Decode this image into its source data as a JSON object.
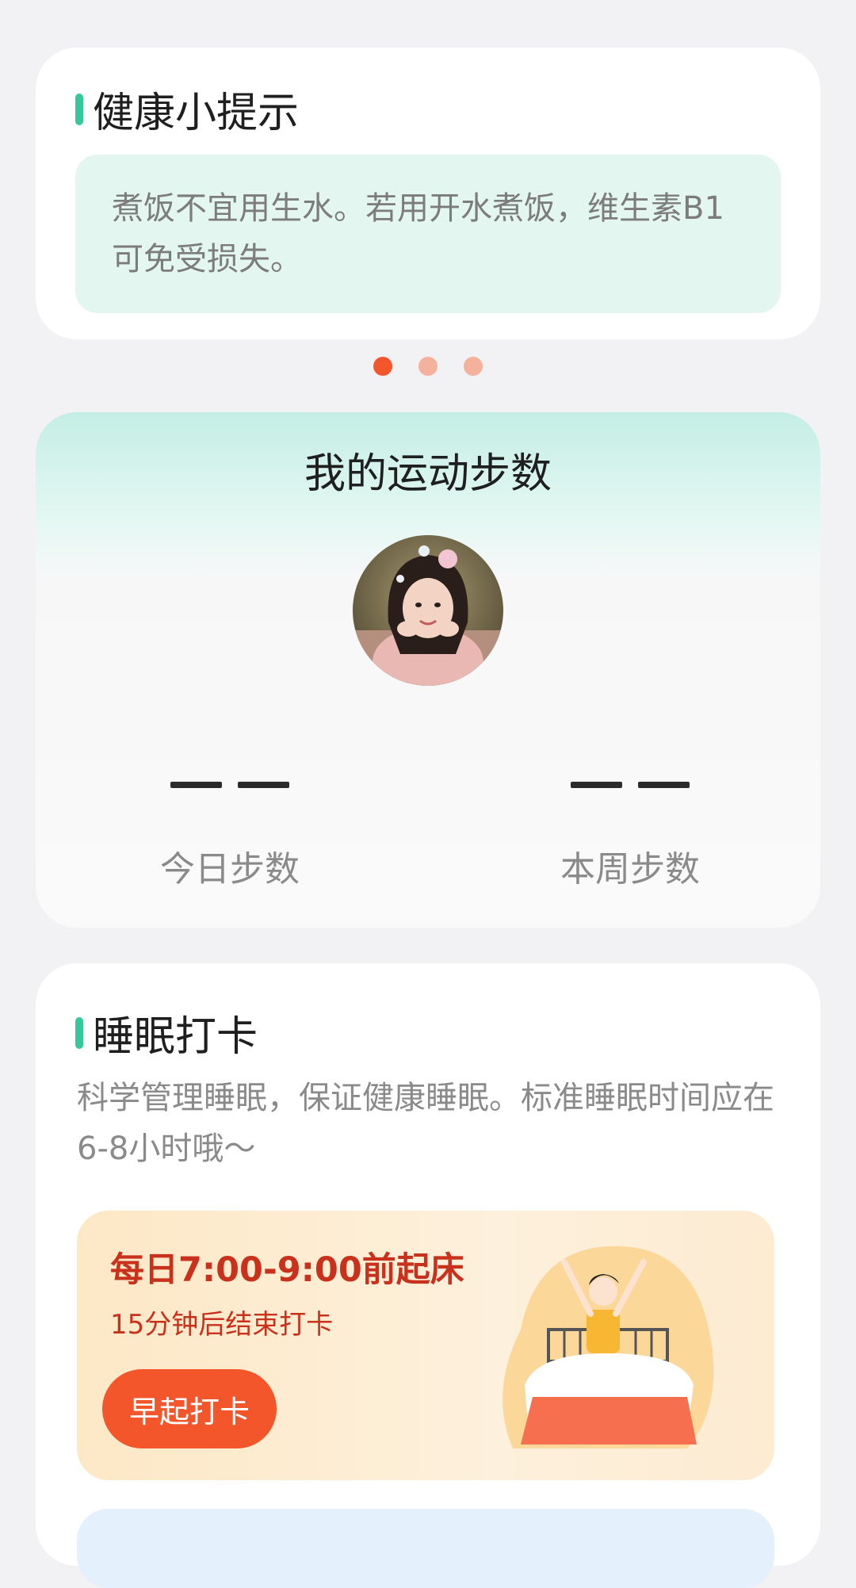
{
  "tip": {
    "title": "健康小提示",
    "text": "煮饭不宜用生水。若用开水煮饭，维生素B1可免受损失。"
  },
  "carousel": {
    "page_count": 3,
    "active_index": 0,
    "active_color": "#f4562c",
    "inactive_color": "#f4b19c"
  },
  "steps": {
    "title": "我的运动步数",
    "today_label": "今日步数",
    "week_label": "本周步数"
  },
  "sleep": {
    "title": "睡眠打卡",
    "description": "科学管理睡眠，保证健康睡眠。标准睡眠时间应在6-8小时哦～",
    "wake": {
      "title": "每日7:00-9:00前起床",
      "subtitle": "15分钟后结束打卡",
      "button_label": "早起打卡"
    }
  },
  "colors": {
    "accent_green": "#35c99a",
    "accent_orange": "#f4562c",
    "wake_text": "#c8321c"
  }
}
